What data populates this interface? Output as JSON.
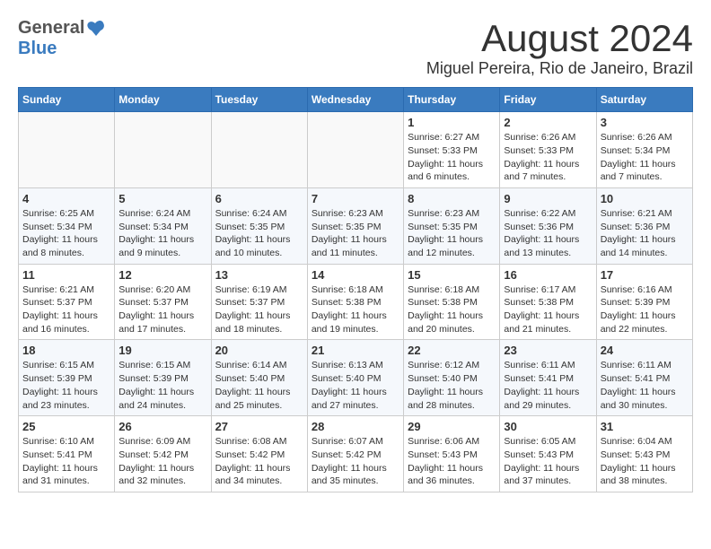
{
  "header": {
    "logo_general": "General",
    "logo_blue": "Blue",
    "main_title": "August 2024",
    "subtitle": "Miguel Pereira, Rio de Janeiro, Brazil"
  },
  "calendar": {
    "days_of_week": [
      "Sunday",
      "Monday",
      "Tuesday",
      "Wednesday",
      "Thursday",
      "Friday",
      "Saturday"
    ],
    "weeks": [
      [
        {
          "day": "",
          "info": ""
        },
        {
          "day": "",
          "info": ""
        },
        {
          "day": "",
          "info": ""
        },
        {
          "day": "",
          "info": ""
        },
        {
          "day": "1",
          "info": "Sunrise: 6:27 AM\nSunset: 5:33 PM\nDaylight: 11 hours and 6 minutes."
        },
        {
          "day": "2",
          "info": "Sunrise: 6:26 AM\nSunset: 5:33 PM\nDaylight: 11 hours and 7 minutes."
        },
        {
          "day": "3",
          "info": "Sunrise: 6:26 AM\nSunset: 5:34 PM\nDaylight: 11 hours and 7 minutes."
        }
      ],
      [
        {
          "day": "4",
          "info": "Sunrise: 6:25 AM\nSunset: 5:34 PM\nDaylight: 11 hours and 8 minutes."
        },
        {
          "day": "5",
          "info": "Sunrise: 6:24 AM\nSunset: 5:34 PM\nDaylight: 11 hours and 9 minutes."
        },
        {
          "day": "6",
          "info": "Sunrise: 6:24 AM\nSunset: 5:35 PM\nDaylight: 11 hours and 10 minutes."
        },
        {
          "day": "7",
          "info": "Sunrise: 6:23 AM\nSunset: 5:35 PM\nDaylight: 11 hours and 11 minutes."
        },
        {
          "day": "8",
          "info": "Sunrise: 6:23 AM\nSunset: 5:35 PM\nDaylight: 11 hours and 12 minutes."
        },
        {
          "day": "9",
          "info": "Sunrise: 6:22 AM\nSunset: 5:36 PM\nDaylight: 11 hours and 13 minutes."
        },
        {
          "day": "10",
          "info": "Sunrise: 6:21 AM\nSunset: 5:36 PM\nDaylight: 11 hours and 14 minutes."
        }
      ],
      [
        {
          "day": "11",
          "info": "Sunrise: 6:21 AM\nSunset: 5:37 PM\nDaylight: 11 hours and 16 minutes."
        },
        {
          "day": "12",
          "info": "Sunrise: 6:20 AM\nSunset: 5:37 PM\nDaylight: 11 hours and 17 minutes."
        },
        {
          "day": "13",
          "info": "Sunrise: 6:19 AM\nSunset: 5:37 PM\nDaylight: 11 hours and 18 minutes."
        },
        {
          "day": "14",
          "info": "Sunrise: 6:18 AM\nSunset: 5:38 PM\nDaylight: 11 hours and 19 minutes."
        },
        {
          "day": "15",
          "info": "Sunrise: 6:18 AM\nSunset: 5:38 PM\nDaylight: 11 hours and 20 minutes."
        },
        {
          "day": "16",
          "info": "Sunrise: 6:17 AM\nSunset: 5:38 PM\nDaylight: 11 hours and 21 minutes."
        },
        {
          "day": "17",
          "info": "Sunrise: 6:16 AM\nSunset: 5:39 PM\nDaylight: 11 hours and 22 minutes."
        }
      ],
      [
        {
          "day": "18",
          "info": "Sunrise: 6:15 AM\nSunset: 5:39 PM\nDaylight: 11 hours and 23 minutes."
        },
        {
          "day": "19",
          "info": "Sunrise: 6:15 AM\nSunset: 5:39 PM\nDaylight: 11 hours and 24 minutes."
        },
        {
          "day": "20",
          "info": "Sunrise: 6:14 AM\nSunset: 5:40 PM\nDaylight: 11 hours and 25 minutes."
        },
        {
          "day": "21",
          "info": "Sunrise: 6:13 AM\nSunset: 5:40 PM\nDaylight: 11 hours and 27 minutes."
        },
        {
          "day": "22",
          "info": "Sunrise: 6:12 AM\nSunset: 5:40 PM\nDaylight: 11 hours and 28 minutes."
        },
        {
          "day": "23",
          "info": "Sunrise: 6:11 AM\nSunset: 5:41 PM\nDaylight: 11 hours and 29 minutes."
        },
        {
          "day": "24",
          "info": "Sunrise: 6:11 AM\nSunset: 5:41 PM\nDaylight: 11 hours and 30 minutes."
        }
      ],
      [
        {
          "day": "25",
          "info": "Sunrise: 6:10 AM\nSunset: 5:41 PM\nDaylight: 11 hours and 31 minutes."
        },
        {
          "day": "26",
          "info": "Sunrise: 6:09 AM\nSunset: 5:42 PM\nDaylight: 11 hours and 32 minutes."
        },
        {
          "day": "27",
          "info": "Sunrise: 6:08 AM\nSunset: 5:42 PM\nDaylight: 11 hours and 34 minutes."
        },
        {
          "day": "28",
          "info": "Sunrise: 6:07 AM\nSunset: 5:42 PM\nDaylight: 11 hours and 35 minutes."
        },
        {
          "day": "29",
          "info": "Sunrise: 6:06 AM\nSunset: 5:43 PM\nDaylight: 11 hours and 36 minutes."
        },
        {
          "day": "30",
          "info": "Sunrise: 6:05 AM\nSunset: 5:43 PM\nDaylight: 11 hours and 37 minutes."
        },
        {
          "day": "31",
          "info": "Sunrise: 6:04 AM\nSunset: 5:43 PM\nDaylight: 11 hours and 38 minutes."
        }
      ]
    ]
  }
}
